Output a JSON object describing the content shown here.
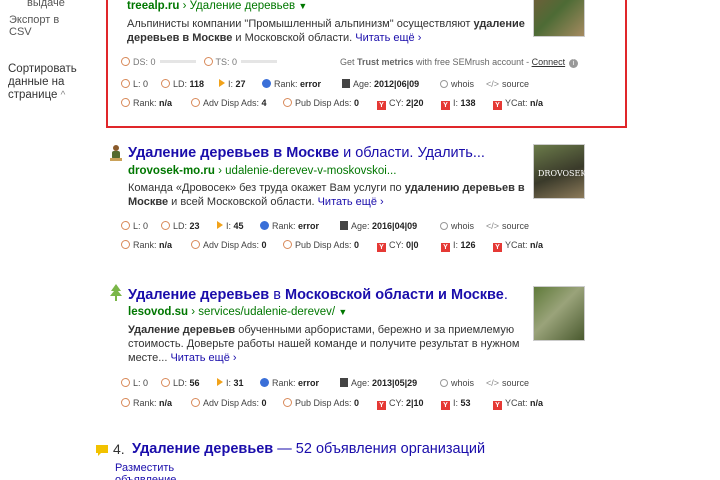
{
  "sidebar": {
    "partial_label": "выдаче",
    "export_label": "Экспорт в CSV",
    "sort_label": "Сортировать данные на странице",
    "sort_chevron": "^"
  },
  "results": [
    {
      "title_bold": "",
      "title_plain": "",
      "domain": "treealp.ru",
      "path": "› Удаление деревьев",
      "snippet_parts": [
        "Альпинисты компании \"Промышленный альпинизм\" осуществляют ",
        "удаление деревьев в Москве",
        " и Московской области. "
      ],
      "more": "Читать ещё ›",
      "ds_label": "DS: 0",
      "ts_label": "TS: 0",
      "trust_text_1": "Get ",
      "trust_bold": "Trust metrics",
      "trust_text_2": " with free SEMrush account - ",
      "trust_link": "Connect",
      "metrics_row1": {
        "l": "0",
        "ld": "118",
        "i": "27",
        "rank": "error",
        "age": "2012|06|09",
        "whois": "whois",
        "source": "source"
      },
      "metrics_row2": {
        "rank": "n/a",
        "adv": "4",
        "pub": "0",
        "cy": "2|20",
        "iy": "138",
        "ycat": "n/a"
      }
    },
    {
      "title_part1": "Удаление деревьев в Москве",
      "title_part2": " и области. Удалить...",
      "domain": "drovosek-mo.ru",
      "path": "› udalenie-derevev-v-moskovskoi...",
      "snippet_parts": [
        "Команда «Дровосек» без труда окажет Вам услуги по ",
        "удалению деревьев",
        " ",
        "в Москве",
        " и всей Московской области. "
      ],
      "more": "Читать ещё ›",
      "metrics_row1": {
        "l": "0",
        "ld": "23",
        "i": "45",
        "rank": "error",
        "age": "2016|04|09",
        "whois": "whois",
        "source": "source"
      },
      "metrics_row2": {
        "rank": "n/a",
        "adv": "0",
        "pub": "0",
        "cy": "0|0",
        "iy": "126",
        "ycat": "n/a"
      }
    },
    {
      "title_part1": "Удаление деревьев",
      "title_part2": " в ",
      "title_part3": "Московской области и Москве",
      "title_part4": ".",
      "domain": "lesovod.su",
      "path": "› services/udalenie-derevev/",
      "snippet_parts": [
        "Удаление деревьев",
        " обученными арбористами, бережно и за приемлемую стоимость. Доверьте работы нашей команде и получите результат в нужном месте... "
      ],
      "more": "Читать ещё ›",
      "metrics_row1": {
        "l": "0",
        "ld": "56",
        "i": "31",
        "rank": "error",
        "age": "2013|05|29",
        "whois": "whois",
        "source": "source"
      },
      "metrics_row2": {
        "rank": "n/a",
        "adv": "0",
        "pub": "0",
        "cy": "2|10",
        "iy": "53",
        "ycat": "n/a"
      }
    }
  ],
  "result4": {
    "num": "4.",
    "title_bold": "Удаление деревьев",
    "title_plain": " — 52 объявления организаций",
    "place_ad": "Разместить объявление"
  },
  "labels": {
    "l": "L:",
    "ld": "LD:",
    "i": "I:",
    "rank": "Rank:",
    "age": "Age:",
    "adv": "Adv Disp Ads:",
    "pub": "Pub Disp Ads:",
    "cy": "CY:",
    "iy": "I:",
    "ycat": "YCat:"
  },
  "colors": {
    "frame": "#e0262a",
    "link": "#1a0dab",
    "url": "#007700"
  }
}
